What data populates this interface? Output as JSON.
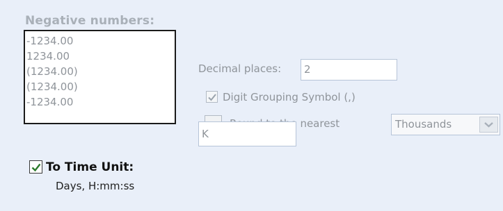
{
  "negative_numbers": {
    "heading": "Negative numbers:",
    "options": [
      "-1234.00",
      "1234.00",
      "(1234.00)",
      "(1234.00)",
      "-1234.00"
    ]
  },
  "decimal_places": {
    "label": "Decimal places:",
    "value": "2"
  },
  "digit_grouping": {
    "label": "Digit Grouping Symbol (,)",
    "checked": true
  },
  "round_to_nearest": {
    "label": "Round to the nearest",
    "checked": false,
    "selected": "Thousands"
  },
  "suffix": {
    "value": "K"
  },
  "time_unit": {
    "label": "To Time Unit:",
    "checked": true,
    "format": "Days, H:mm:ss"
  },
  "colors": {
    "panel_background": "#e9eff9",
    "disabled_text": "#8f949a",
    "check_green": "#2a7a2a",
    "check_disabled": "#9aa3ad"
  }
}
